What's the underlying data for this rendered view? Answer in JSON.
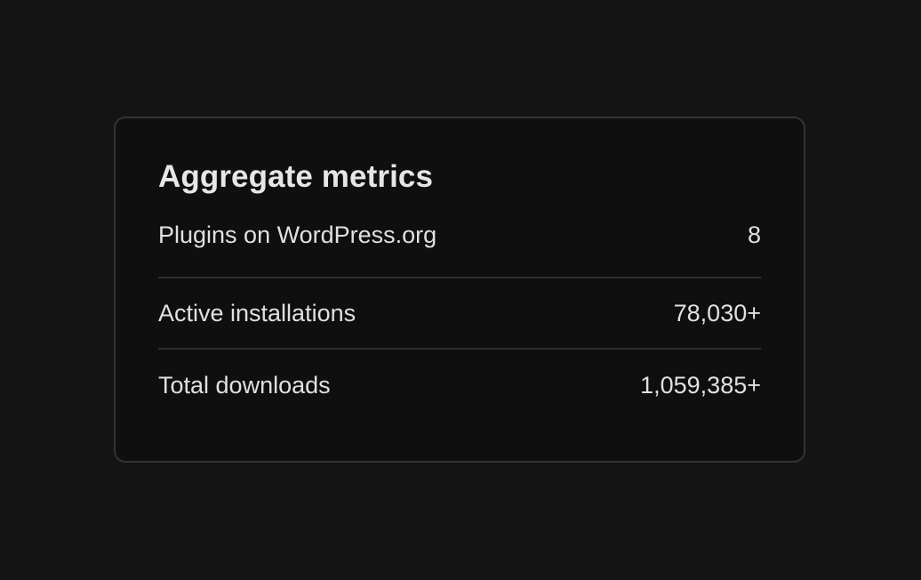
{
  "card": {
    "title": "Aggregate metrics",
    "rows": [
      {
        "label": "Plugins on WordPress.org",
        "value": "8"
      },
      {
        "label": "Active installations",
        "value": "78,030+"
      },
      {
        "label": "Total downloads",
        "value": "1,059,385+"
      }
    ]
  },
  "colors": {
    "page_background": "#141414",
    "card_background": "#0f0f0f",
    "card_border": "#333333",
    "divider": "#2e2e2e",
    "text": "#e4e4e4"
  }
}
